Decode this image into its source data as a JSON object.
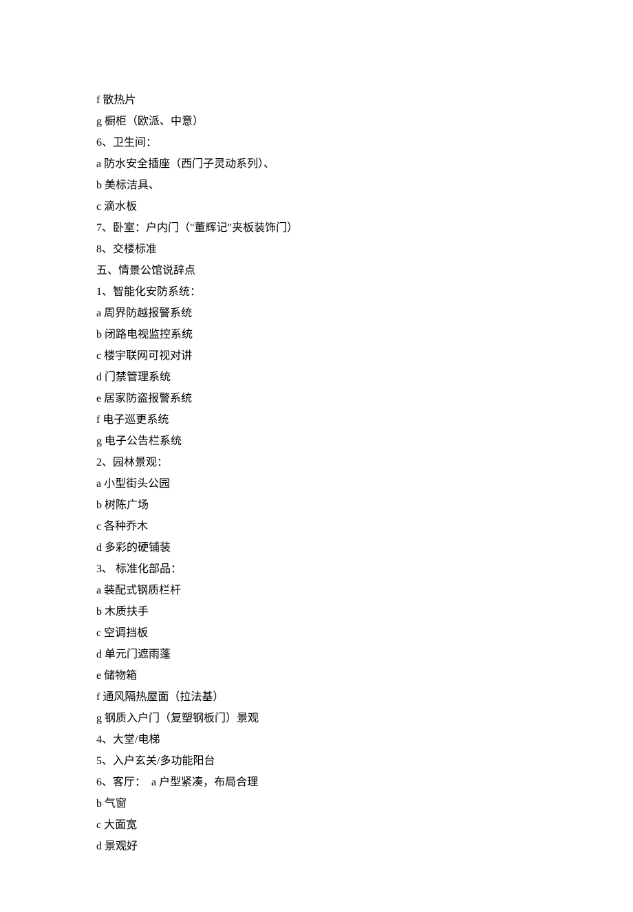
{
  "lines": [
    "f 散热片",
    "g 橱柜（欧派、中意）",
    "6、卫生间：",
    "a 防水安全插座（西门子灵动系列）、",
    "b 美标洁具、",
    "c 滴水板",
    "7、卧室：户内门（\"董辉记\"夹板装饰门）",
    "8、交楼标准",
    "五、情景公馆说辞点",
    "1、智能化安防系统：",
    "a 周界防越报警系统",
    "b 闭路电视监控系统",
    "c 楼宇联网可视对讲",
    "d 门禁管理系统",
    "e 居家防盗报警系统",
    "f 电子巡更系统",
    "g 电子公告栏系统",
    "2、园林景观：",
    "a 小型街头公园",
    "b 树陈广场",
    "c 各种乔木",
    "d 多彩的硬铺装",
    "3、 标准化部品：",
    "a 装配式钢质栏杆",
    "b 木质扶手",
    "c 空调挡板",
    "d 单元门遮雨蓬",
    "e 储物箱",
    "f 通风隔热屋面（拉法基）",
    "g 钢质入户门（复塑钢板门）景观",
    "4、大堂/电梯",
    "5、入户玄关/多功能阳台",
    "6、客厅：  a 户型紧凑，布局合理",
    "b 气窗",
    "c 大面宽",
    "d 景观好"
  ]
}
